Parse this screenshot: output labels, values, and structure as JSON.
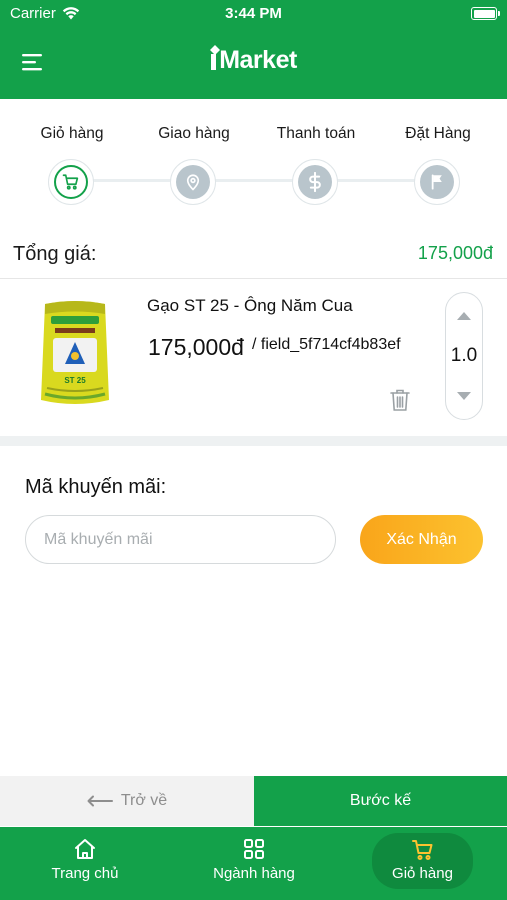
{
  "status_bar": {
    "carrier": "Carrier",
    "time": "3:44 PM"
  },
  "header": {
    "logo_text": "Market",
    "menu_icon": "hamburger-menu-icon"
  },
  "checkout_steps": [
    {
      "label": "Giỏ hàng",
      "icon": "cart-icon",
      "active": true
    },
    {
      "label": "Giao hàng",
      "icon": "location-pin-icon",
      "active": false
    },
    {
      "label": "Thanh toán",
      "icon": "dollar-icon",
      "active": false
    },
    {
      "label": "Đặt Hàng",
      "icon": "flag-icon",
      "active": false
    }
  ],
  "summary": {
    "total_label": "Tổng giá:",
    "total_value": "175,000đ"
  },
  "cart_item": {
    "name": "Gạo ST 25 - Ông Năm Cua",
    "price": "175,000đ",
    "unit": "/ field_5f714cf4b83ef",
    "quantity": "1.0",
    "image_label": "ST 25"
  },
  "promo": {
    "title": "Mã khuyến mãi:",
    "placeholder": "Mã khuyến mãi",
    "value": "",
    "submit_label": "Xác Nhận"
  },
  "navigation": {
    "back_label": "Trở về",
    "next_label": "Bước kế"
  },
  "tabbar": [
    {
      "label": "Trang chủ",
      "icon": "home-icon",
      "active": false
    },
    {
      "label": "Ngành hàng",
      "icon": "grid-icon",
      "active": false
    },
    {
      "label": "Giỏ hàng",
      "icon": "cart-icon",
      "active": true
    }
  ],
  "colors": {
    "brand_green": "#13a14a",
    "price_green": "#13a14a",
    "confirm_orange": "#fbb526",
    "step_gray": "#b9c5cc"
  }
}
